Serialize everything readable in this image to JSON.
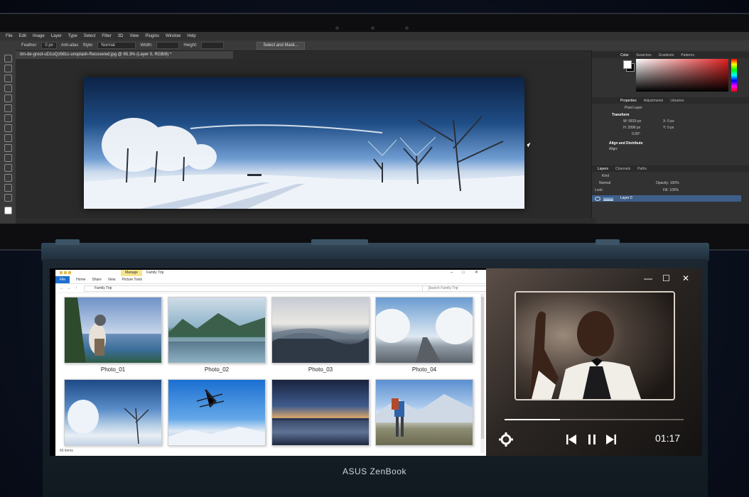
{
  "top_app": {
    "menu": [
      "File",
      "Edit",
      "Image",
      "Layer",
      "Type",
      "Select",
      "Filter",
      "3D",
      "View",
      "Plugins",
      "Window",
      "Help"
    ],
    "options": {
      "feather_label": "Feather:",
      "feather_value": "0 px",
      "antialias_label": "Anti-alias",
      "style_label": "Style:",
      "style_value": "Normal",
      "width_label": "Width:",
      "height_label": "Height:",
      "select_mask_label": "Select and Mask..."
    },
    "document_tab": "tim-de-groot-uD1oQz681c-unsplash-Recovered.jpg @ 65.3% (Layer 0, RGB/8) *",
    "panels": {
      "color_tabs": [
        "Color",
        "Swatches",
        "Gradients",
        "Patterns"
      ],
      "props_tabs": [
        "Properties",
        "Adjustments",
        "Libraries"
      ],
      "pixel_layer": "Pixel Layer",
      "transform": "Transform",
      "w_value": "W: 5819 px",
      "h_value": "H: 2996 px",
      "x_value": "X: 0 px",
      "y_value": "Y: 0 px",
      "angle_value": "0.00°",
      "align_distribute": "Align and Distribute",
      "align_label": "Align:",
      "layers_tabs": [
        "Layers",
        "Channels",
        "Paths"
      ],
      "kind_label": "Kind",
      "normal_label": "Normal",
      "opacity_label": "Opacity: 100%",
      "lock_label": "Lock:",
      "fill_label": "Fill: 100%",
      "layer_name": "Layer 0"
    }
  },
  "explorer": {
    "manage_tab": "Manage",
    "window_title": "Family Trip",
    "ribbon_tabs": [
      "File",
      "Home",
      "Share",
      "View",
      "Picture Tools"
    ],
    "address": "Family Trip",
    "search_placeholder": "Search Family Trip",
    "photos": [
      "Photo_01",
      "Photo_02",
      "Photo_03",
      "Photo_04"
    ],
    "status": "66 items"
  },
  "player": {
    "time": "01:17",
    "progress": 0.31,
    "icons": {
      "minimize": "minimize-icon",
      "maximize": "maximize-icon",
      "close": "close-icon",
      "settings": "settings-gear-icon",
      "previous": "skip-previous-icon",
      "pause": "pause-icon",
      "next": "skip-next-icon"
    }
  },
  "brand": "ASUS ZenBook",
  "colors": {
    "accent_blue": "#1e6fcf",
    "manage_yellow": "#f6e58f",
    "ps_dark": "#2b2b2b"
  }
}
